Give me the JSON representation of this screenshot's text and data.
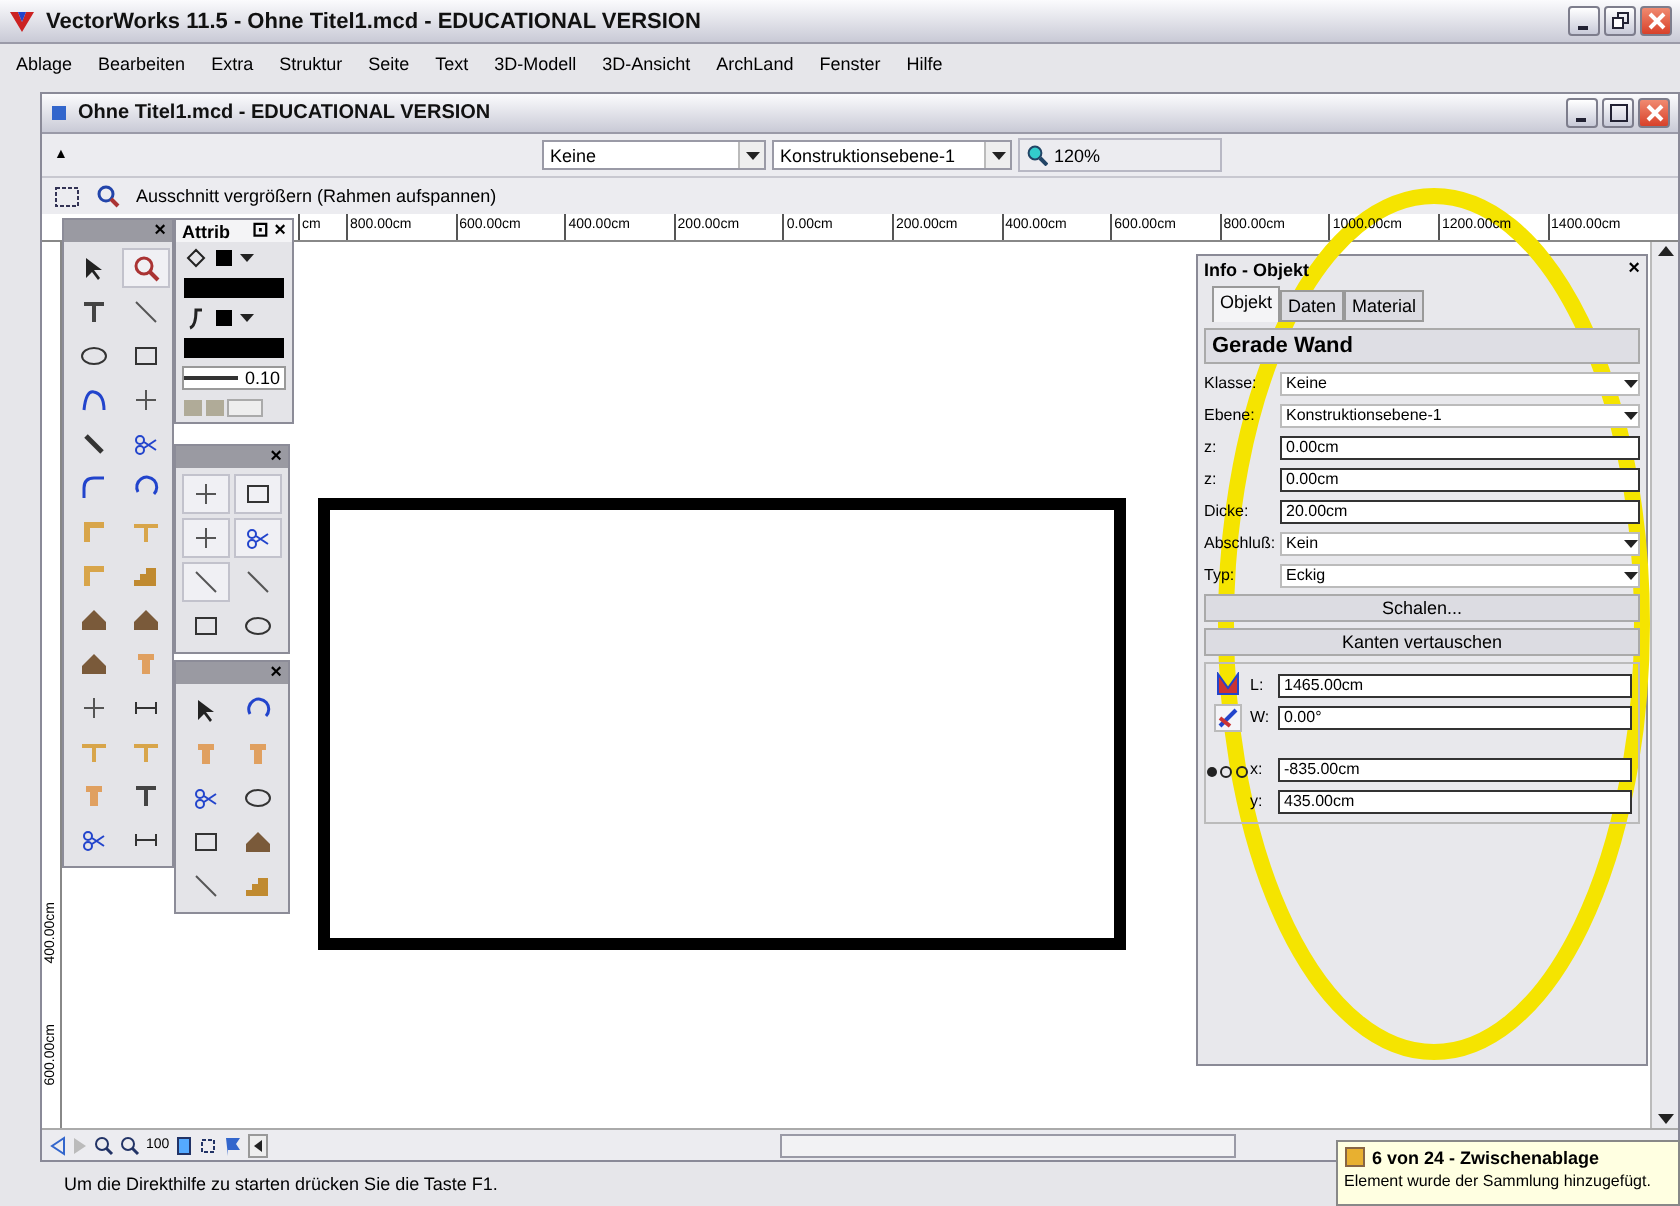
{
  "app": {
    "title": "VectorWorks 11.5 - Ohne Titel1.mcd - EDUCATIONAL VERSION"
  },
  "menu": [
    "Ablage",
    "Bearbeiten",
    "Extra",
    "Struktur",
    "Seite",
    "Text",
    "3D-Modell",
    "3D-Ansicht",
    "ArchLand",
    "Fenster",
    "Hilfe"
  ],
  "document": {
    "title": "Ohne Titel1.mcd - EDUCATIONAL VERSION"
  },
  "toolbar": {
    "arrow": "▲",
    "class": "Keine",
    "layer": "Konstruktionsebene-1",
    "zoom": "120%"
  },
  "view_bar": {
    "hint": "Ausschnitt vergrößern (Rahmen aufspannen)"
  },
  "ruler": {
    "top": [
      "cm",
      "800.00cm",
      "600.00cm",
      "400.00cm",
      "200.00cm",
      "0.00cm",
      "200.00cm",
      "400.00cm",
      "600.00cm",
      "800.00cm",
      "1000.00cm",
      "1200.00cm",
      "1400.00cm"
    ],
    "left": [
      "400.00cm",
      "600.00cm"
    ]
  },
  "palettes": {
    "tools": {
      "close": "×"
    },
    "attributes": {
      "title": "Attrib",
      "pin": "⊡",
      "close": "×",
      "line_weight": "0.10"
    },
    "constraints": {
      "close": "×"
    },
    "visualization": {
      "close": "×"
    }
  },
  "info": {
    "title": "Info - Objekt",
    "close": "×",
    "tabs": [
      {
        "label": "Objekt",
        "selected": true
      },
      {
        "label": "Daten",
        "selected": false
      },
      {
        "label": "Material",
        "selected": false
      }
    ],
    "heading": "Gerade Wand",
    "fields": [
      {
        "kind": "select",
        "label": "Klasse:",
        "value": "Keine"
      },
      {
        "kind": "select",
        "label": "Ebene:",
        "value": "Konstruktionsebene-1"
      },
      {
        "kind": "input",
        "label": "z:",
        "value": "0.00cm"
      },
      {
        "kind": "input",
        "label": "z:",
        "value": "0.00cm"
      },
      {
        "kind": "input",
        "label": "Dicke:",
        "value": "20.00cm"
      },
      {
        "kind": "select",
        "label": "Abschluß:",
        "value": "Kein"
      },
      {
        "kind": "select",
        "label": "Typ:",
        "value": "Eckig"
      }
    ],
    "buttons": [
      "Schalen...",
      "Kanten vertauschen"
    ],
    "geometry": [
      {
        "label": "L:",
        "value": "1465.00cm"
      },
      {
        "label": "W:",
        "value": "0.00°"
      },
      {
        "label": "x:",
        "value": "-835.00cm"
      },
      {
        "label": "y:",
        "value": "435.00cm"
      }
    ]
  },
  "nav": {
    "scale": "100"
  },
  "status_bar": "Um die Direkthilfe zu starten drücken Sie die Taste F1.",
  "notification": {
    "title": "6 von 24 - Zwischenablage",
    "message": "Element wurde der Sammlung hinzugefügt."
  },
  "annotation": {
    "kind": "ellipse"
  }
}
